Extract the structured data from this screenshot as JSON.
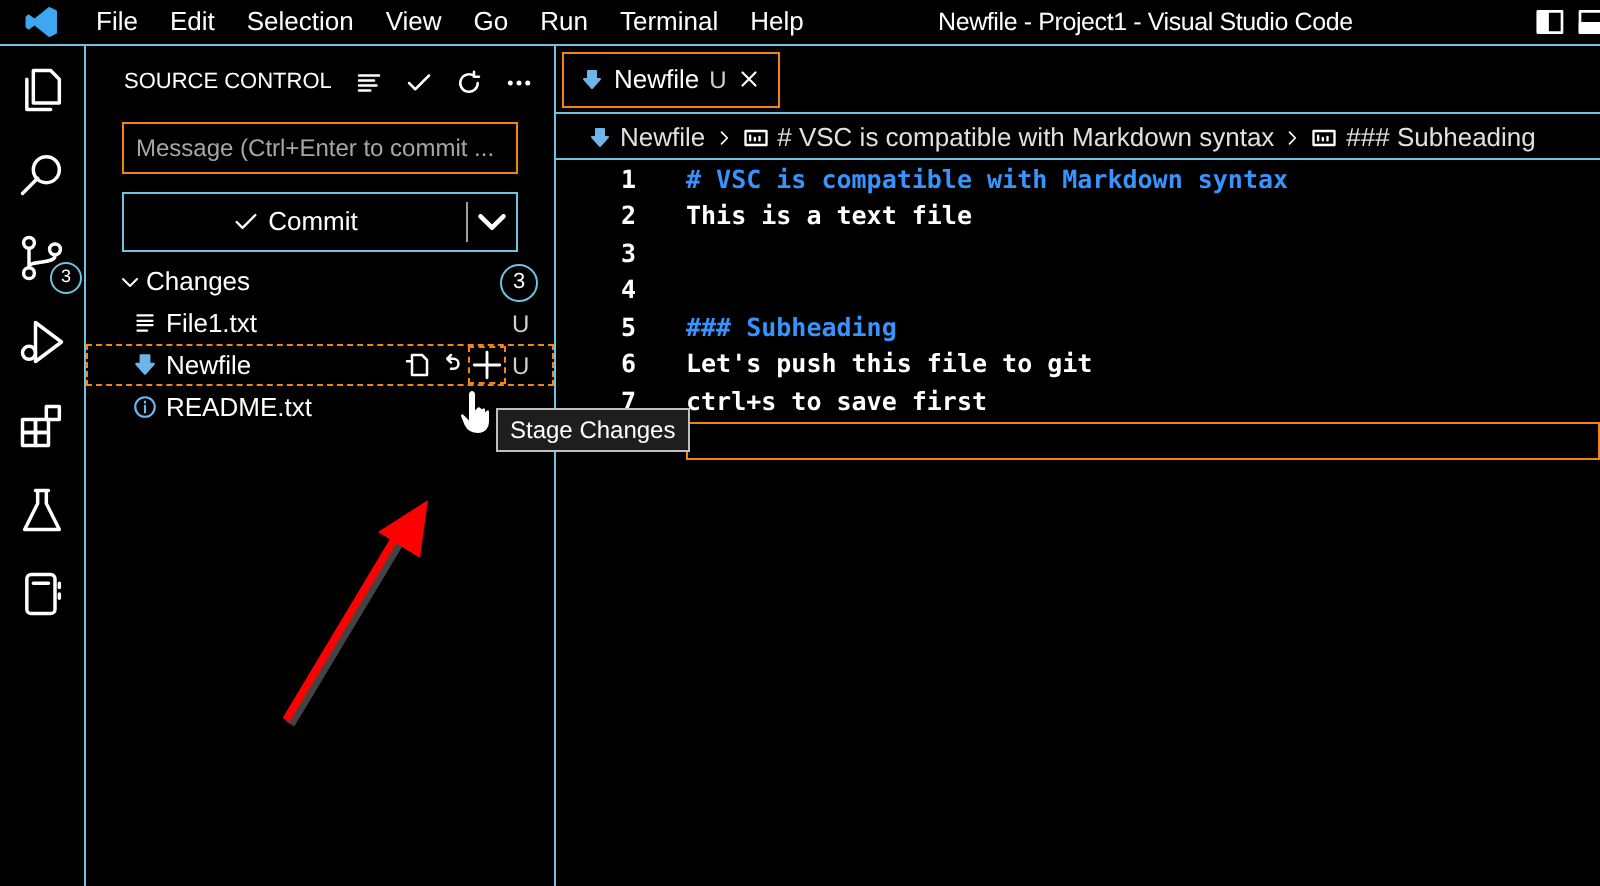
{
  "menu": [
    "File",
    "Edit",
    "Selection",
    "View",
    "Go",
    "Run",
    "Terminal",
    "Help"
  ],
  "window": {
    "title": "Newfile - Project1 - Visual Studio Code"
  },
  "activity_bar": [
    {
      "kind": "explorer"
    },
    {
      "kind": "search"
    },
    {
      "kind": "source-control",
      "badge": "3"
    },
    {
      "kind": "run"
    },
    {
      "kind": "extensions"
    },
    {
      "kind": "testing"
    },
    {
      "kind": "notebook"
    }
  ],
  "sidebar": {
    "title": "SOURCE CONTROL",
    "message": {
      "placeholder": "Message (Ctrl+Enter to commit ...",
      "focused": true
    },
    "commit_button": "Commit",
    "changes": {
      "label": "Changes",
      "count": "3",
      "expanded": true,
      "files": [
        {
          "name": "File1.txt",
          "kind": "text",
          "status": "U",
          "focused": false
        },
        {
          "name": "Newfile",
          "kind": "markdown",
          "status": "U",
          "focused": true
        },
        {
          "name": "README.txt",
          "kind": "info",
          "focused": false
        }
      ]
    }
  },
  "tooltip": "Stage Changes",
  "editor": {
    "tabs": [
      {
        "label": "Newfile",
        "status": "U",
        "selected": true
      }
    ],
    "breadcrumbs": [
      "Newfile",
      "# VSC is compatible with Markdown syntax",
      "### Subheading"
    ],
    "lines": [
      {
        "number": "1",
        "text": "# VSC is compatible with Markdown syntax",
        "kind": "heading"
      },
      {
        "number": "2",
        "text": "This is a text file",
        "kind": "plain"
      },
      {
        "number": "3"
      },
      {
        "number": "4"
      },
      {
        "number": "5",
        "text": "### Subheading",
        "kind": "heading"
      },
      {
        "number": "6",
        "text": "Let's push this file to git",
        "kind": "plain"
      },
      {
        "number": "7",
        "text": "ctrl+s to save first",
        "kind": "plain"
      }
    ],
    "current_line": true
  }
}
